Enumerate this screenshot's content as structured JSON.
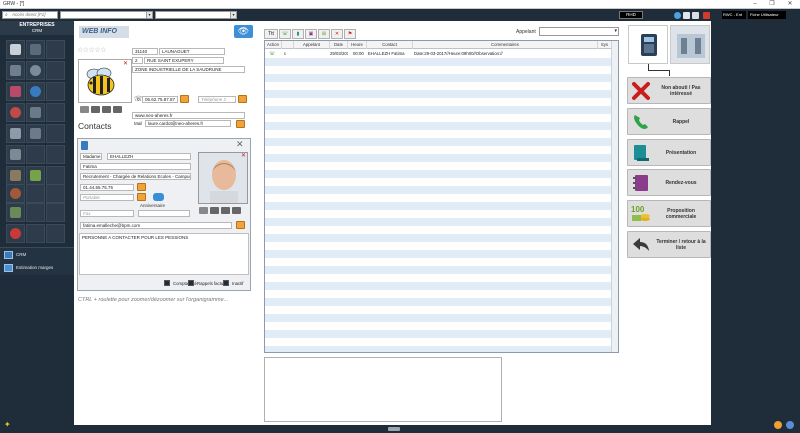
{
  "window": {
    "title": "GRW - [*]",
    "minimize": "–",
    "maximize": "❐",
    "close": "✕"
  },
  "topbar": {
    "search_placeholder": "Accès direct [F2]",
    "badge": "RHD",
    "user_short": "RWC - Ent",
    "user_role": "Fiche Utilisateur"
  },
  "sidebar": {
    "header_line1": "ENTREPRISES",
    "header_line2": "CRM",
    "menu": [
      {
        "label": "CRM",
        "icon": "crm-icon"
      },
      {
        "label": "Estimation marges",
        "icon": "chart-icon"
      }
    ]
  },
  "company": {
    "logo_text": "WEB INFO",
    "rating": "☆☆☆☆☆",
    "postcode": "31140",
    "city": "LAUNAGUET",
    "street_number": "2",
    "street": "RUE SAINT EXUPERY",
    "address2": "ZONE INDUSTRIELLE DE LA SAUDRUNE",
    "phone": "05.62.75.87.87",
    "phone2_placeholder": "Téléphone 2",
    "website": "www.neo-aheres.fr",
    "mail_label": "Mail",
    "email": "laure.cardot@neo-aheres.fr"
  },
  "contacts": {
    "title": "Contacts",
    "civility": "Madame",
    "last_name": "EHALLEZH",
    "first_name": "Fatima",
    "position": "Recrutement - Chargée de Relations Ecoles - Campus",
    "phone": "01.44.55.75.75",
    "mobile_placeholder": "Portable",
    "anniversary_label": "Anniversaire",
    "fax_placeholder": "Fax",
    "email": "fatima.emalleche@bpm.com",
    "notes": "PERSONNE A CONTACTER POUR LES PESSIONS",
    "checkboxes": [
      {
        "label": "Comptabilité"
      },
      {
        "label": "Rappels factures"
      },
      {
        "label": "Inactif"
      }
    ],
    "hint": "CTRL + roulette pour zoomer/dézoomer sur l'organigramme..."
  },
  "actions_table": {
    "filter_label": "Appelant",
    "toolbar": [
      {
        "label": "Ttt",
        "icon": "check-icon"
      },
      {
        "label": "☏",
        "icon": "phone-icon"
      },
      {
        "label": "▮",
        "icon": "document-icon"
      },
      {
        "label": "▣",
        "icon": "book-icon"
      },
      {
        "label": "⊞",
        "icon": "coins-icon"
      },
      {
        "label": "✕",
        "icon": "delete-icon"
      },
      {
        "label": "⚑",
        "icon": "flag-icon"
      }
    ],
    "columns": [
      "Action",
      "",
      "Appelant",
      "Date",
      "Heure",
      "Contact",
      "Commentaires",
      "Sys"
    ],
    "rows": [
      {
        "type": "☏",
        "flag": "c",
        "appelant": "",
        "date": "29/03/201",
        "time": "00:00",
        "contact": "EHALLEZH Fatima",
        "comment": "Date:29-03-2017//Heure:09h00//Observation://",
        "sys": ""
      }
    ]
  },
  "right_actions": [
    {
      "label": "Non abouti / Pas intéressé",
      "icon": "red-cross-icon"
    },
    {
      "label": "Rappel",
      "icon": "phone-icon"
    },
    {
      "label": "Présentation",
      "icon": "document-icon"
    },
    {
      "label": "Rendez-vous",
      "icon": "agenda-icon"
    },
    {
      "label": "Proposition commerciale",
      "icon": "money-icon"
    },
    {
      "label": "Terminer / retour à la liste",
      "icon": "back-arrow-icon"
    }
  ],
  "colors": {
    "dark_bg": "#1f2c3a",
    "accent_blue": "#3d8fd6",
    "row_alt": "#e2ecf6",
    "action_gray": "#dedede"
  }
}
